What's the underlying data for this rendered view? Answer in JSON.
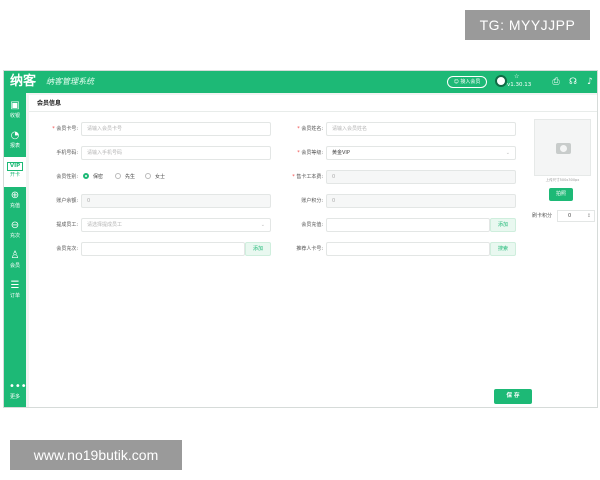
{
  "watermarks": {
    "top": "TG: MYYJJPP",
    "bottom": "www.no19butik.com"
  },
  "header": {
    "logo": "纳客",
    "slogan": "纳客管理系统",
    "join_label": "☺ 接入会员",
    "version": "v1.30.13",
    "version_star": "☆"
  },
  "sidebar": {
    "items": [
      {
        "label": "收银",
        "icon": "cashier-icon"
      },
      {
        "label": "报表",
        "icon": "report-chart-icon"
      },
      {
        "label": "开卡",
        "icon": "vip-card-icon",
        "badge": "VIP",
        "active": true
      },
      {
        "label": "充值",
        "icon": "recharge-icon"
      },
      {
        "label": "充次",
        "icon": "recharge-count-icon"
      },
      {
        "label": "会员",
        "icon": "member-icon"
      },
      {
        "label": "订单",
        "icon": "order-list-icon"
      },
      {
        "label": "更多",
        "icon": "more-dots-icon"
      }
    ]
  },
  "page": {
    "title": "会员信息"
  },
  "form": {
    "card_no": {
      "label": "会员卡号:",
      "placeholder": "请输入会员卡号"
    },
    "name": {
      "label": "会员姓名:",
      "placeholder": "请输入会员姓名"
    },
    "phone": {
      "label": "手机号码:",
      "placeholder": "请输入手机号码"
    },
    "level": {
      "label": "会员等级:",
      "value": "黄金VIP"
    },
    "gender": {
      "label": "会员性别:",
      "options": [
        "保密",
        "先生",
        "女士"
      ],
      "selected": "保密"
    },
    "card_fee": {
      "label": "售卡工本费:",
      "value": "0"
    },
    "balance": {
      "label": "账户余额:",
      "value": "0"
    },
    "points": {
      "label": "账户积分:",
      "value": "0"
    },
    "staff": {
      "label": "提成员工:",
      "placeholder": "请选择提成员工"
    },
    "recharge": {
      "label": "会员充值:",
      "button": "添加"
    },
    "count_recharge": {
      "label": "会员充次:",
      "button": "添加"
    },
    "referrer": {
      "label": "推荐人卡号:",
      "button": "搜索"
    }
  },
  "photo": {
    "hint": "上传尺寸500x300px",
    "button": "拍照"
  },
  "card_points": {
    "label": "刷卡积分",
    "value": "0",
    "arrow": "↕"
  },
  "actions": {
    "save": "保 存"
  },
  "colors": {
    "brand": "#1db976",
    "required": "#f04848"
  }
}
